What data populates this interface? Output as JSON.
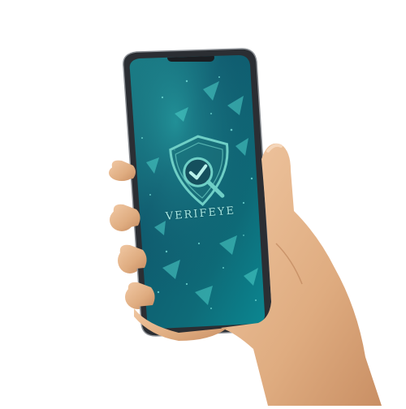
{
  "app": {
    "brand_name": "VERIFEYE",
    "logo_icon": "shield-check-magnifier-icon"
  },
  "colors": {
    "screen_top": "#0f3f55",
    "screen_mid": "#0e6a74",
    "screen_bottom": "#0c7b86",
    "accent": "#2fb5b0",
    "logo": "#6fcfc6",
    "phone_frame": "#2b2e33",
    "skin": "#e7b98f"
  }
}
